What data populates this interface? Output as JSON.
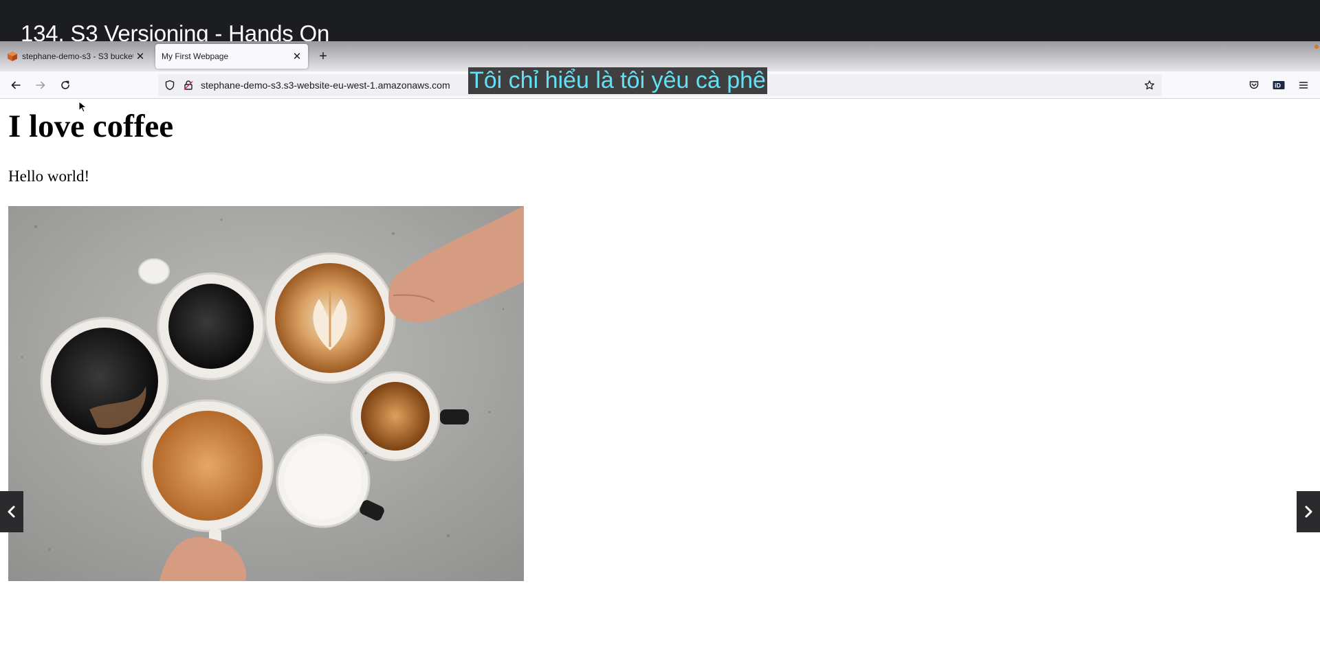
{
  "video": {
    "title": "134. S3 Versioning - Hands On",
    "subtitle": "Tôi chỉ hiểu là tôi yêu cà phê"
  },
  "browser": {
    "tabs": [
      {
        "label": "stephane-demo-s3 - S3 bucket",
        "icon": "aws-s3-icon",
        "active": false
      },
      {
        "label": "My First Webpage",
        "icon": "",
        "active": true
      }
    ],
    "new_tab_icon": "plus-icon",
    "url": "stephane-demo-s3.s3-website-eu-west-1.amazonaws.com",
    "toolbar_icons": [
      "back-icon",
      "forward-icon",
      "reload-icon",
      "shield-icon",
      "insecure-lock-icon",
      "bookmark-star-icon",
      "pocket-icon",
      "extension-id-icon",
      "menu-icon"
    ]
  },
  "page": {
    "heading": "I love coffee",
    "paragraph": "Hello world!",
    "image_alt": "coffee cups on concrete"
  },
  "player": {
    "prev_icon": "chevron-left-icon",
    "next_icon": "chevron-right-icon"
  },
  "colors": {
    "title_bar": "#1c1d20",
    "subtitle_bg": "#3f3f3f",
    "subtitle_text": "#63e0f4",
    "aws_orange": "#d4621e"
  }
}
